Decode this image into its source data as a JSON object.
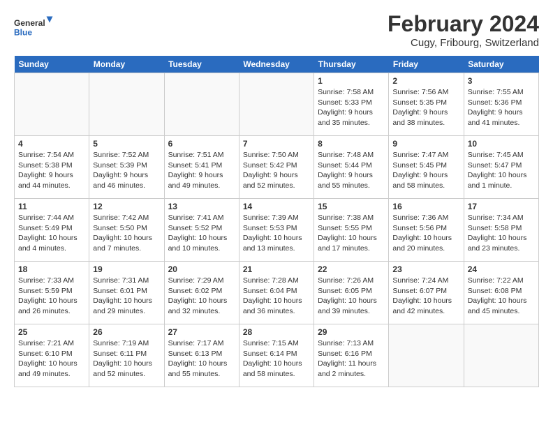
{
  "header": {
    "logo_general": "General",
    "logo_blue": "Blue",
    "title": "February 2024",
    "subtitle": "Cugy, Fribourg, Switzerland"
  },
  "weekdays": [
    "Sunday",
    "Monday",
    "Tuesday",
    "Wednesday",
    "Thursday",
    "Friday",
    "Saturday"
  ],
  "weeks": [
    [
      {
        "day": "",
        "info": ""
      },
      {
        "day": "",
        "info": ""
      },
      {
        "day": "",
        "info": ""
      },
      {
        "day": "",
        "info": ""
      },
      {
        "day": "1",
        "info": "Sunrise: 7:58 AM\nSunset: 5:33 PM\nDaylight: 9 hours\nand 35 minutes."
      },
      {
        "day": "2",
        "info": "Sunrise: 7:56 AM\nSunset: 5:35 PM\nDaylight: 9 hours\nand 38 minutes."
      },
      {
        "day": "3",
        "info": "Sunrise: 7:55 AM\nSunset: 5:36 PM\nDaylight: 9 hours\nand 41 minutes."
      }
    ],
    [
      {
        "day": "4",
        "info": "Sunrise: 7:54 AM\nSunset: 5:38 PM\nDaylight: 9 hours\nand 44 minutes."
      },
      {
        "day": "5",
        "info": "Sunrise: 7:52 AM\nSunset: 5:39 PM\nDaylight: 9 hours\nand 46 minutes."
      },
      {
        "day": "6",
        "info": "Sunrise: 7:51 AM\nSunset: 5:41 PM\nDaylight: 9 hours\nand 49 minutes."
      },
      {
        "day": "7",
        "info": "Sunrise: 7:50 AM\nSunset: 5:42 PM\nDaylight: 9 hours\nand 52 minutes."
      },
      {
        "day": "8",
        "info": "Sunrise: 7:48 AM\nSunset: 5:44 PM\nDaylight: 9 hours\nand 55 minutes."
      },
      {
        "day": "9",
        "info": "Sunrise: 7:47 AM\nSunset: 5:45 PM\nDaylight: 9 hours\nand 58 minutes."
      },
      {
        "day": "10",
        "info": "Sunrise: 7:45 AM\nSunset: 5:47 PM\nDaylight: 10 hours\nand 1 minute."
      }
    ],
    [
      {
        "day": "11",
        "info": "Sunrise: 7:44 AM\nSunset: 5:49 PM\nDaylight: 10 hours\nand 4 minutes."
      },
      {
        "day": "12",
        "info": "Sunrise: 7:42 AM\nSunset: 5:50 PM\nDaylight: 10 hours\nand 7 minutes."
      },
      {
        "day": "13",
        "info": "Sunrise: 7:41 AM\nSunset: 5:52 PM\nDaylight: 10 hours\nand 10 minutes."
      },
      {
        "day": "14",
        "info": "Sunrise: 7:39 AM\nSunset: 5:53 PM\nDaylight: 10 hours\nand 13 minutes."
      },
      {
        "day": "15",
        "info": "Sunrise: 7:38 AM\nSunset: 5:55 PM\nDaylight: 10 hours\nand 17 minutes."
      },
      {
        "day": "16",
        "info": "Sunrise: 7:36 AM\nSunset: 5:56 PM\nDaylight: 10 hours\nand 20 minutes."
      },
      {
        "day": "17",
        "info": "Sunrise: 7:34 AM\nSunset: 5:58 PM\nDaylight: 10 hours\nand 23 minutes."
      }
    ],
    [
      {
        "day": "18",
        "info": "Sunrise: 7:33 AM\nSunset: 5:59 PM\nDaylight: 10 hours\nand 26 minutes."
      },
      {
        "day": "19",
        "info": "Sunrise: 7:31 AM\nSunset: 6:01 PM\nDaylight: 10 hours\nand 29 minutes."
      },
      {
        "day": "20",
        "info": "Sunrise: 7:29 AM\nSunset: 6:02 PM\nDaylight: 10 hours\nand 32 minutes."
      },
      {
        "day": "21",
        "info": "Sunrise: 7:28 AM\nSunset: 6:04 PM\nDaylight: 10 hours\nand 36 minutes."
      },
      {
        "day": "22",
        "info": "Sunrise: 7:26 AM\nSunset: 6:05 PM\nDaylight: 10 hours\nand 39 minutes."
      },
      {
        "day": "23",
        "info": "Sunrise: 7:24 AM\nSunset: 6:07 PM\nDaylight: 10 hours\nand 42 minutes."
      },
      {
        "day": "24",
        "info": "Sunrise: 7:22 AM\nSunset: 6:08 PM\nDaylight: 10 hours\nand 45 minutes."
      }
    ],
    [
      {
        "day": "25",
        "info": "Sunrise: 7:21 AM\nSunset: 6:10 PM\nDaylight: 10 hours\nand 49 minutes."
      },
      {
        "day": "26",
        "info": "Sunrise: 7:19 AM\nSunset: 6:11 PM\nDaylight: 10 hours\nand 52 minutes."
      },
      {
        "day": "27",
        "info": "Sunrise: 7:17 AM\nSunset: 6:13 PM\nDaylight: 10 hours\nand 55 minutes."
      },
      {
        "day": "28",
        "info": "Sunrise: 7:15 AM\nSunset: 6:14 PM\nDaylight: 10 hours\nand 58 minutes."
      },
      {
        "day": "29",
        "info": "Sunrise: 7:13 AM\nSunset: 6:16 PM\nDaylight: 11 hours\nand 2 minutes."
      },
      {
        "day": "",
        "info": ""
      },
      {
        "day": "",
        "info": ""
      }
    ]
  ]
}
